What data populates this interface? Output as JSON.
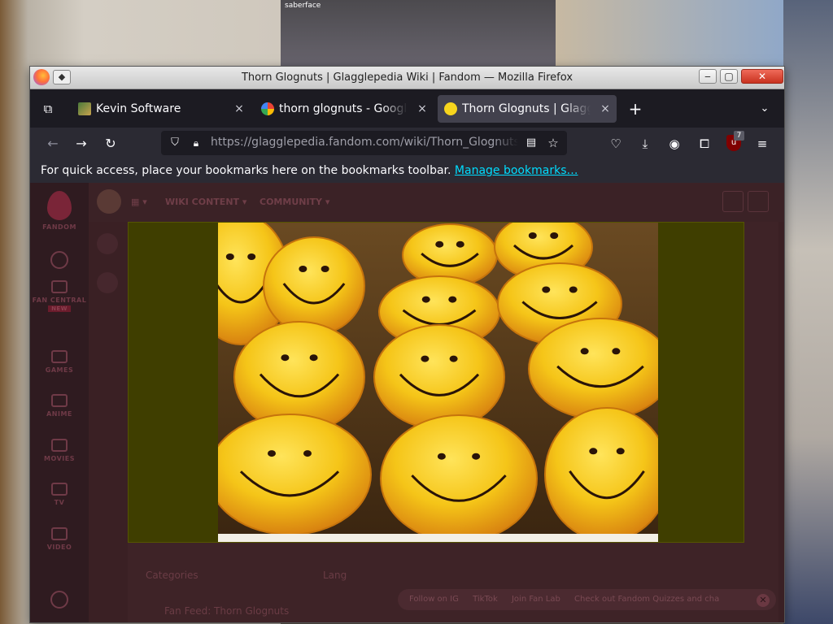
{
  "background": {
    "video_call_label": "saberface"
  },
  "window": {
    "title": "Thorn Glognuts | Glagglepedia Wiki | Fandom — Mozilla Firefox",
    "minimize_label": "‒",
    "maximize_label": "▢",
    "close_label": "✕"
  },
  "tabs": [
    {
      "label": "Kevin Software",
      "icon": "kevin-software-favicon"
    },
    {
      "label": "thorn glognuts - Google Search",
      "icon": "google-favicon"
    },
    {
      "label": "Thorn Glognuts | Glagglepedia Wiki",
      "icon": "smiley-favicon",
      "active": true
    }
  ],
  "tab_close_label": "×",
  "new_tab_label": "+",
  "list_tabs_label": "⌄",
  "navbar": {
    "url": "https://glagglepedia.fandom.com/wiki/Thorn_Glognuts",
    "extension_badge": "7"
  },
  "bookmarks_bar": {
    "prompt": "For quick access, place your bookmarks here on the bookmarks toolbar.",
    "link": "Manage bookmarks…"
  },
  "fandom": {
    "brand": "FANDOM",
    "rail": [
      "FAN CENTRAL",
      "GAMES",
      "ANIME",
      "MOVIES",
      "TV",
      "VIDEO"
    ],
    "rail_new": "NEW",
    "nav": [
      "WIKI CONTENT",
      "COMMUNITY"
    ],
    "faded": {
      "categories": "Categories",
      "languages": "Lang",
      "bottom_link": "Fan Feed: Thorn Glognuts"
    },
    "footer": [
      "Follow on IG",
      "TikTok",
      "Join Fan Lab",
      "Check out Fandom Quizzes and cha"
    ]
  },
  "colors": {
    "lightbox_bg": "#3f3e00",
    "donut": "#f5c518",
    "active_tab": "#42414d",
    "link": "#00ddff"
  }
}
